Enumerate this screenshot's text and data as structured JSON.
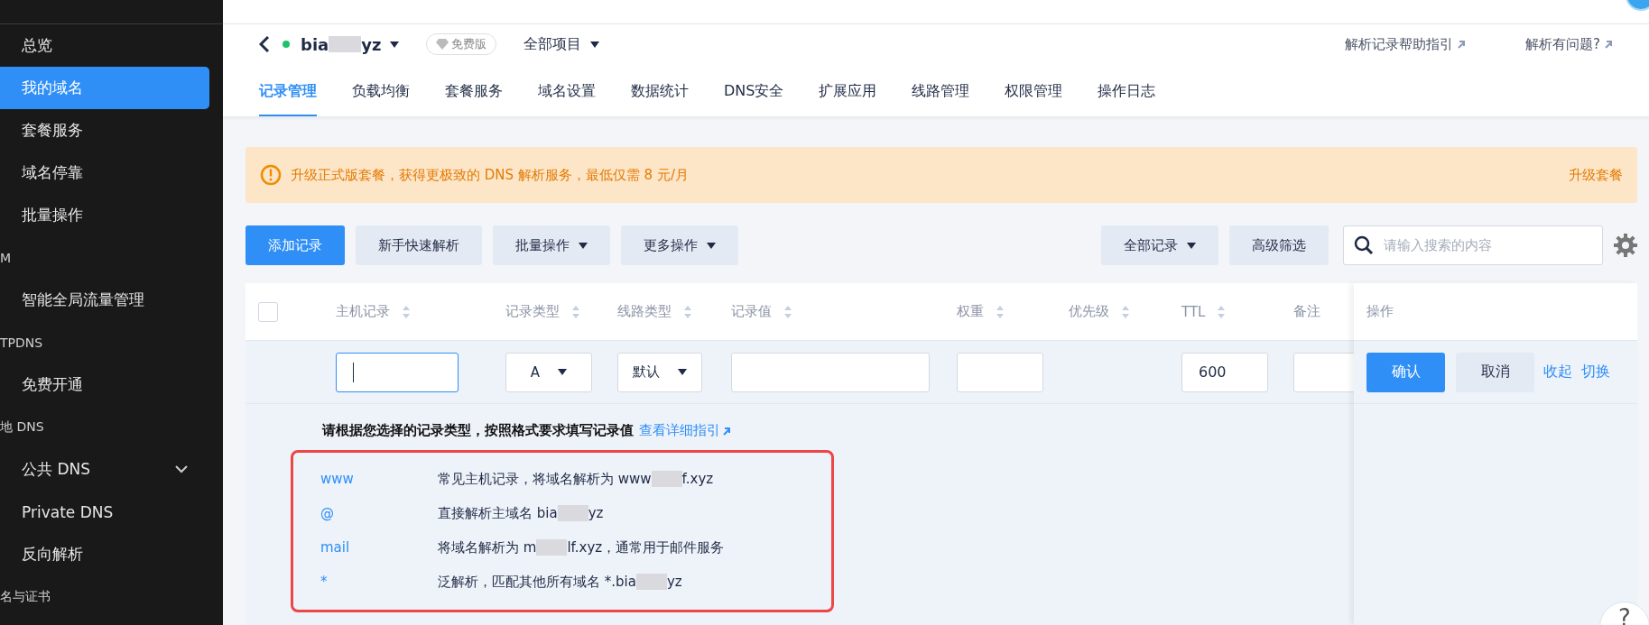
{
  "sidebar": {
    "items": [
      {
        "kind": "item",
        "label": "总览",
        "selected": false
      },
      {
        "kind": "item",
        "label": "我的域名",
        "selected": true
      },
      {
        "kind": "item",
        "label": "套餐服务",
        "selected": false
      },
      {
        "kind": "item",
        "label": "域名停靠",
        "selected": false
      },
      {
        "kind": "item",
        "label": "批量操作",
        "selected": false
      },
      {
        "kind": "group",
        "label": "M"
      },
      {
        "kind": "item",
        "label": "智能全局流量管理",
        "selected": false
      },
      {
        "kind": "group",
        "label": "TPDNS"
      },
      {
        "kind": "item",
        "label": "免费开通",
        "selected": false
      },
      {
        "kind": "group",
        "label": "地 DNS"
      },
      {
        "kind": "folder",
        "label": "公共 DNS",
        "selected": false
      },
      {
        "kind": "item",
        "label": "Private DNS",
        "selected": false
      },
      {
        "kind": "item",
        "label": "反向解析",
        "selected": false
      },
      {
        "kind": "group",
        "label": "名与证书"
      }
    ]
  },
  "domain": {
    "prefix": "bia",
    "suffix": "yz",
    "color": "#1fc26b",
    "plan_badge": "免费版",
    "project": "全部项目"
  },
  "help_links": [
    "解析记录帮助指引",
    "解析有问题?"
  ],
  "tabs": [
    {
      "label": "记录管理",
      "selected": true
    },
    {
      "label": "负载均衡",
      "selected": false
    },
    {
      "label": "套餐服务",
      "selected": false
    },
    {
      "label": "域名设置",
      "selected": false
    },
    {
      "label": "数据统计",
      "selected": false
    },
    {
      "label": "DNS安全",
      "selected": false
    },
    {
      "label": "扩展应用",
      "selected": false
    },
    {
      "label": "线路管理",
      "selected": false
    },
    {
      "label": "权限管理",
      "selected": false
    },
    {
      "label": "操作日志",
      "selected": false
    }
  ],
  "banner": {
    "text": "升级正式版套餐，获得更极致的 DNS 解析服务，最低仅需 8 元/月",
    "action": "升级套餐"
  },
  "toolbar": {
    "left": [
      {
        "label": "添加记录",
        "kind": "primary"
      },
      {
        "label": "新手快速解析",
        "kind": "plain"
      },
      {
        "label": "批量操作",
        "kind": "dropdown"
      },
      {
        "label": "更多操作",
        "kind": "dropdown"
      }
    ],
    "right": [
      {
        "label": "全部记录",
        "kind": "dropdown"
      },
      {
        "label": "高级筛选",
        "kind": "plain"
      }
    ],
    "search": {
      "placeholder": "请输入搜索的内容"
    }
  },
  "table": {
    "select_all": {
      "checked": false
    },
    "columns": [
      {
        "label": "主机记录",
        "sortable": true
      },
      {
        "label": "记录类型",
        "sortable": true
      },
      {
        "label": "线路类型",
        "sortable": true
      },
      {
        "label": "记录值",
        "sortable": true
      },
      {
        "label": "权重",
        "sortable": true
      },
      {
        "label": "优先级",
        "sortable": true
      },
      {
        "label": "TTL",
        "sortable": true
      },
      {
        "label": "备注",
        "sortable": false
      }
    ],
    "action_column": "操作",
    "edit_row": [
      {
        "kind": "input",
        "focused": true
      },
      {
        "kind": "select",
        "value": "A"
      },
      {
        "kind": "select",
        "value": "默认"
      },
      {
        "kind": "input",
        "focused": false
      },
      {
        "kind": "input",
        "focused": false
      },
      {
        "kind": "none"
      },
      {
        "kind": "input",
        "focused": false,
        "value": "600"
      },
      {
        "kind": "input",
        "focused": false
      }
    ],
    "actions": [
      {
        "label": "确认",
        "kind": "primary"
      },
      {
        "label": "取消",
        "kind": "plain"
      },
      {
        "label": "收起",
        "kind": "link"
      },
      {
        "label": "切换",
        "kind": "link"
      }
    ]
  },
  "hint": {
    "title": "请根据您选择的记录类型，按照格式要求填写记录值",
    "link": "查看详细指引",
    "examples": [
      {
        "host": "www",
        "before": "常见主机记录，将域名解析为 www",
        "after": "f.xyz"
      },
      {
        "host": "@",
        "before": "直接解析主域名 bia",
        "after": "yz"
      },
      {
        "host": "mail",
        "before": "将域名解析为 m",
        "after": "lf.xyz，通常用于邮件服务"
      },
      {
        "host": "*",
        "before": "泛解析，匹配其他所有域名 *.bia",
        "after": "yz"
      }
    ]
  },
  "help_button": "?"
}
